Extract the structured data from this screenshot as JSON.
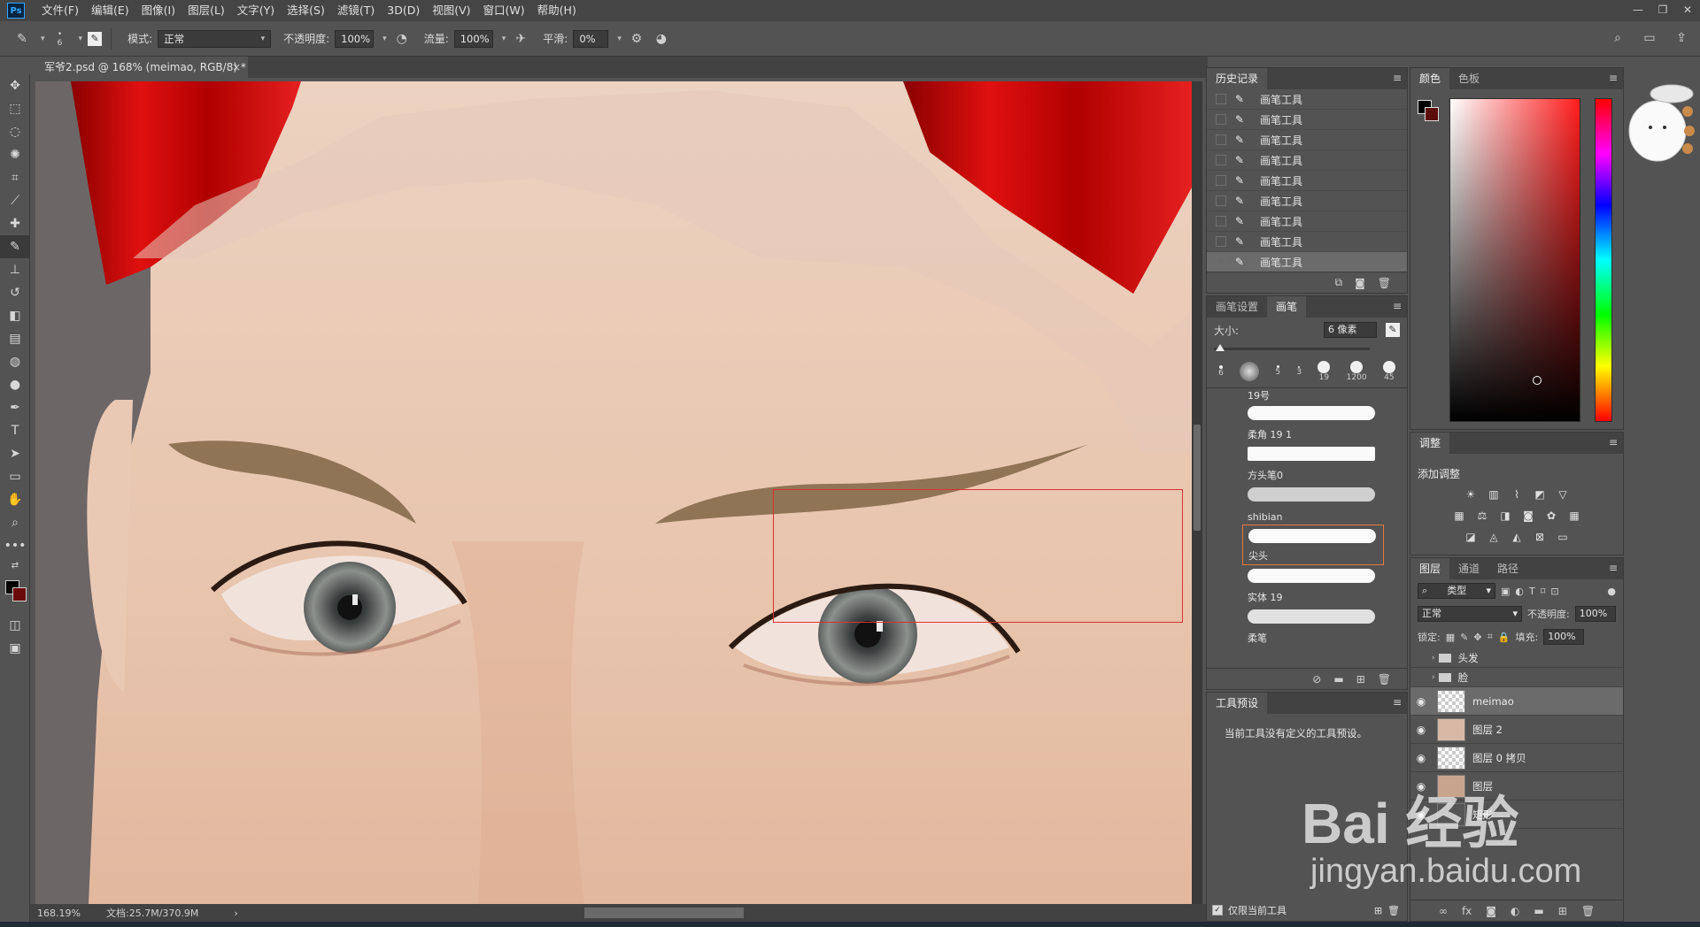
{
  "menubar": {
    "logo": "Ps",
    "items": [
      "文件(F)",
      "编辑(E)",
      "图像(I)",
      "图层(L)",
      "文字(Y)",
      "选择(S)",
      "滤镜(T)",
      "3D(D)",
      "视图(V)",
      "窗口(W)",
      "帮助(H)"
    ]
  },
  "options": {
    "brush_size": "6",
    "mode_label": "模式:",
    "mode_value": "正常",
    "opacity_label": "不透明度:",
    "opacity_value": "100%",
    "flow_label": "流量:",
    "flow_value": "100%",
    "smoothing_label": "平滑:",
    "smoothing_value": "0%"
  },
  "document": {
    "tab_title": "军爷2.psd @ 168% (meimao, RGB/8) *",
    "zoom": "168.19%",
    "doc_size": "文档:25.7M/370.9M"
  },
  "history": {
    "tab_label": "历史记录",
    "items": [
      "画笔工具",
      "画笔工具",
      "画笔工具",
      "画笔工具",
      "画笔工具",
      "画笔工具",
      "画笔工具",
      "画笔工具",
      "画笔工具"
    ]
  },
  "brushes": {
    "tab_settings": "画笔设置",
    "tab_brush": "画笔",
    "size_label": "大小:",
    "size_value": "6 像素",
    "presets": [
      "6",
      "",
      "5",
      "3",
      "19",
      "1200",
      "45"
    ],
    "list": [
      {
        "name": "19号"
      },
      {
        "name": "柔角 19 1"
      },
      {
        "name": "方头笔0"
      },
      {
        "name": "shibian"
      },
      {
        "name": "尖头"
      },
      {
        "name": "实体 19"
      },
      {
        "name": "柔笔"
      }
    ]
  },
  "tool_presets": {
    "tab_label": "工具预设",
    "message": "当前工具没有定义的工具预设。",
    "current_only_label": "仅限当前工具"
  },
  "color_panel": {
    "tab_color": "颜色",
    "tab_swatches": "色板",
    "foreground": "#000000",
    "background": "#5d0c0c"
  },
  "adjustments": {
    "tab_label": "调整",
    "title": "添加调整"
  },
  "layers": {
    "tab_layers": "图层",
    "tab_channels": "通道",
    "tab_paths": "路径",
    "filter_label": "类型",
    "blend_mode": "正常",
    "opacity_label": "不透明度:",
    "opacity_value": "100%",
    "lock_label": "锁定:",
    "fill_label": "填充:",
    "fill_value": "100%",
    "items": [
      {
        "name": "头发",
        "type": "group",
        "visible": false
      },
      {
        "name": "脸",
        "type": "group",
        "visible": false
      },
      {
        "name": "meimao",
        "type": "layer",
        "visible": true,
        "selected": true
      },
      {
        "name": "图层 2",
        "type": "layer",
        "visible": true
      },
      {
        "name": "图层 0 拷贝",
        "type": "layer",
        "visible": true
      },
      {
        "name": "图层",
        "type": "layer",
        "visible": true
      },
      {
        "name": "矩形",
        "type": "layer",
        "visible": true
      }
    ]
  },
  "watermark": {
    "main": "Bai 经验",
    "sub": "jingyan.baidu.com"
  }
}
